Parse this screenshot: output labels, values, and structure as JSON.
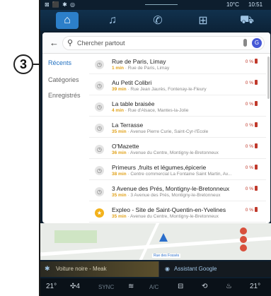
{
  "callout": {
    "number": "3"
  },
  "status": {
    "left_icons": "⊠ ⬛ ✱ ◎",
    "temperature": "10°C",
    "time": "10:51"
  },
  "nav": {
    "tabs": [
      {
        "name": "home",
        "glyph": "⌂",
        "active": true
      },
      {
        "name": "music",
        "glyph": "♫"
      },
      {
        "name": "phone",
        "glyph": "✆"
      },
      {
        "name": "apps",
        "glyph": "⊞"
      },
      {
        "name": "vehicle",
        "glyph": "⛟"
      }
    ]
  },
  "search": {
    "placeholder": "Chercher partout",
    "avatar": "G"
  },
  "sidebar": {
    "items": [
      "Récents",
      "Catégories",
      "Enregistrés"
    ]
  },
  "results": [
    {
      "name": "Rue de Paris, Limay",
      "time": "1 min",
      "address": "Rue de Paris, Limay",
      "battery": "0 %",
      "icon": "history"
    },
    {
      "name": "Au Petit Colibri",
      "time": "39 min",
      "address": "Rue Jean Jaurès, Fontenay-le-Fleury",
      "battery": "0 %",
      "icon": "history"
    },
    {
      "name": "La table braisée",
      "time": "4 min",
      "address": "Rue d'Alsace, Mantes-la-Jolie",
      "battery": "0 %",
      "icon": "history"
    },
    {
      "name": "La Terrasse",
      "time": "35 min",
      "address": "Avenue Pierre Curie, Saint-Cyr-l'École",
      "battery": "0 %",
      "icon": "history"
    },
    {
      "name": "O'Mazette",
      "time": "36 min",
      "address": "Avenue du Centre, Montigny-le-Bretonneux",
      "battery": "0 %",
      "icon": "history"
    },
    {
      "name": "Primeurs ,fruits et légumes,épicerie",
      "time": "38 min",
      "address": "Centre commercial La Fontaine Saint Martin, Av...",
      "battery": "0 %",
      "icon": "history"
    },
    {
      "name": "3 Avenue des Prés, Montigny-le-Bretonneux",
      "time": "35 min",
      "address": "3 Avenue des Prés, Montigny-le-Bretonneux",
      "battery": "0 %",
      "icon": "history"
    },
    {
      "name": "Expleo - Site de Saint-Quentin-en-Yvelines",
      "time": "35 min",
      "address": "Avenue du Centre, Montigny-le-Bretonneux",
      "battery": "0 %",
      "icon": "star"
    }
  ],
  "map": {
    "street_label": "Rue des Fossés"
  },
  "media": {
    "track": "Voiture noire - Meak",
    "assistant": "Assistant Google"
  },
  "climate": {
    "left_temp": "21°",
    "fan": "4",
    "sync": "SYNC",
    "ac": "A/C",
    "right_temp": "21°"
  }
}
